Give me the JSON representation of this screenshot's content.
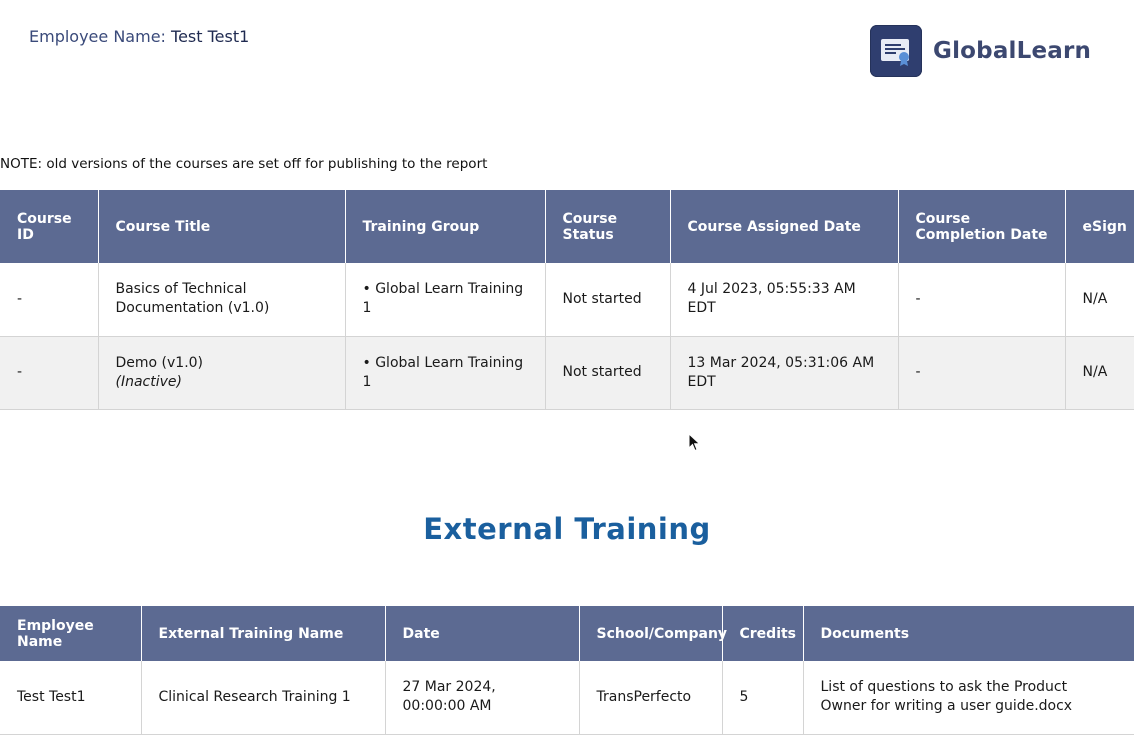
{
  "header": {
    "employee_label": "Employee Name:",
    "employee_value": "Test Test1",
    "logo_text": "GlobalLearn",
    "logo_icon": "certificate-icon"
  },
  "note": "NOTE: old versions of the courses are set off for publishing to the report",
  "courses": {
    "columns": [
      "Course ID",
      "Course Title",
      "Training Group",
      "Course Status",
      "Course Assigned Date",
      "Course Completion Date",
      "eSign"
    ],
    "rows": [
      {
        "id": "-",
        "title": "Basics of Technical Documentation (v1.0)",
        "title_note": "",
        "group": "• Global Learn Training 1",
        "status": "Not started",
        "assigned": "4 Jul 2023, 05:55:33 AM EDT",
        "completed": "-",
        "esign": "N/A"
      },
      {
        "id": "-",
        "title": "Demo (v1.0)",
        "title_note": "(Inactive)",
        "group": "• Global Learn Training 1",
        "status": "Not started",
        "assigned": "13 Mar 2024, 05:31:06 AM EDT",
        "completed": "-",
        "esign": "N/A"
      }
    ]
  },
  "external": {
    "title": "External Training",
    "columns": [
      "Employee Name",
      "External Training Name",
      "Date",
      "School/Company",
      "Credits",
      "Documents"
    ],
    "rows": [
      {
        "employee": "Test Test1",
        "name": "Clinical Research Training 1",
        "date": "27 Mar 2024, 00:00:00 AM",
        "school": "TransPerfecto",
        "credits": "5",
        "documents": "List of questions to ask the Product Owner for writing a user guide.docx"
      }
    ]
  },
  "colors": {
    "header_bg": "#5c6a92",
    "title_blue": "#1a5f9e",
    "logo_bg": "#2f3e6f"
  }
}
